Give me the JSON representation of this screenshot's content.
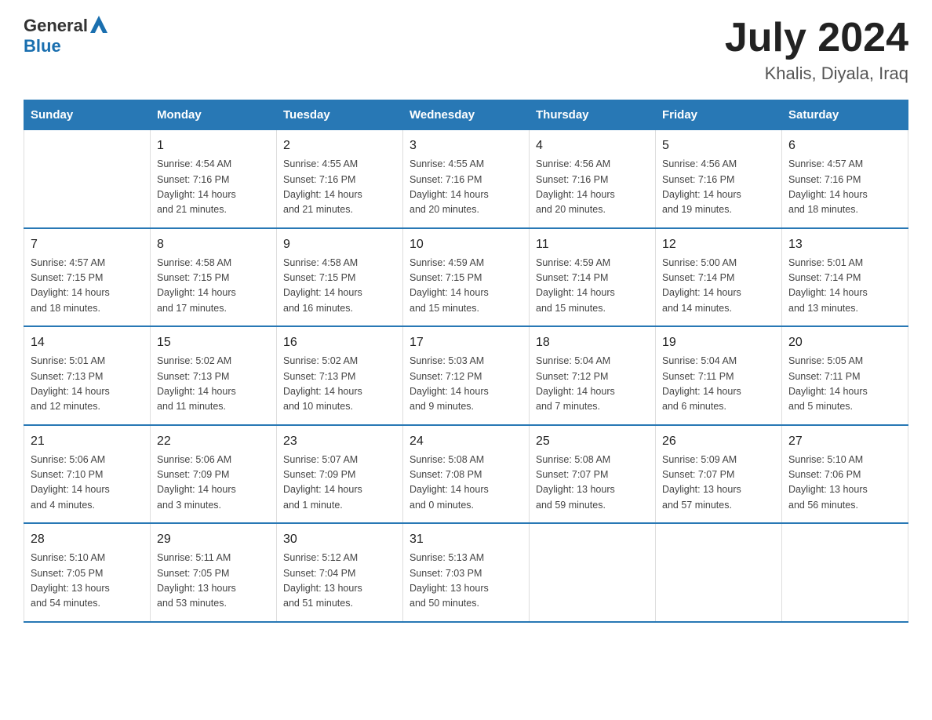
{
  "logo": {
    "text_general": "General",
    "text_blue": "Blue"
  },
  "title": "July 2024",
  "location": "Khalis, Diyala, Iraq",
  "days_of_week": [
    "Sunday",
    "Monday",
    "Tuesday",
    "Wednesday",
    "Thursday",
    "Friday",
    "Saturday"
  ],
  "weeks": [
    [
      {
        "day": "",
        "info": ""
      },
      {
        "day": "1",
        "info": "Sunrise: 4:54 AM\nSunset: 7:16 PM\nDaylight: 14 hours\nand 21 minutes."
      },
      {
        "day": "2",
        "info": "Sunrise: 4:55 AM\nSunset: 7:16 PM\nDaylight: 14 hours\nand 21 minutes."
      },
      {
        "day": "3",
        "info": "Sunrise: 4:55 AM\nSunset: 7:16 PM\nDaylight: 14 hours\nand 20 minutes."
      },
      {
        "day": "4",
        "info": "Sunrise: 4:56 AM\nSunset: 7:16 PM\nDaylight: 14 hours\nand 20 minutes."
      },
      {
        "day": "5",
        "info": "Sunrise: 4:56 AM\nSunset: 7:16 PM\nDaylight: 14 hours\nand 19 minutes."
      },
      {
        "day": "6",
        "info": "Sunrise: 4:57 AM\nSunset: 7:16 PM\nDaylight: 14 hours\nand 18 minutes."
      }
    ],
    [
      {
        "day": "7",
        "info": "Sunrise: 4:57 AM\nSunset: 7:15 PM\nDaylight: 14 hours\nand 18 minutes."
      },
      {
        "day": "8",
        "info": "Sunrise: 4:58 AM\nSunset: 7:15 PM\nDaylight: 14 hours\nand 17 minutes."
      },
      {
        "day": "9",
        "info": "Sunrise: 4:58 AM\nSunset: 7:15 PM\nDaylight: 14 hours\nand 16 minutes."
      },
      {
        "day": "10",
        "info": "Sunrise: 4:59 AM\nSunset: 7:15 PM\nDaylight: 14 hours\nand 15 minutes."
      },
      {
        "day": "11",
        "info": "Sunrise: 4:59 AM\nSunset: 7:14 PM\nDaylight: 14 hours\nand 15 minutes."
      },
      {
        "day": "12",
        "info": "Sunrise: 5:00 AM\nSunset: 7:14 PM\nDaylight: 14 hours\nand 14 minutes."
      },
      {
        "day": "13",
        "info": "Sunrise: 5:01 AM\nSunset: 7:14 PM\nDaylight: 14 hours\nand 13 minutes."
      }
    ],
    [
      {
        "day": "14",
        "info": "Sunrise: 5:01 AM\nSunset: 7:13 PM\nDaylight: 14 hours\nand 12 minutes."
      },
      {
        "day": "15",
        "info": "Sunrise: 5:02 AM\nSunset: 7:13 PM\nDaylight: 14 hours\nand 11 minutes."
      },
      {
        "day": "16",
        "info": "Sunrise: 5:02 AM\nSunset: 7:13 PM\nDaylight: 14 hours\nand 10 minutes."
      },
      {
        "day": "17",
        "info": "Sunrise: 5:03 AM\nSunset: 7:12 PM\nDaylight: 14 hours\nand 9 minutes."
      },
      {
        "day": "18",
        "info": "Sunrise: 5:04 AM\nSunset: 7:12 PM\nDaylight: 14 hours\nand 7 minutes."
      },
      {
        "day": "19",
        "info": "Sunrise: 5:04 AM\nSunset: 7:11 PM\nDaylight: 14 hours\nand 6 minutes."
      },
      {
        "day": "20",
        "info": "Sunrise: 5:05 AM\nSunset: 7:11 PM\nDaylight: 14 hours\nand 5 minutes."
      }
    ],
    [
      {
        "day": "21",
        "info": "Sunrise: 5:06 AM\nSunset: 7:10 PM\nDaylight: 14 hours\nand 4 minutes."
      },
      {
        "day": "22",
        "info": "Sunrise: 5:06 AM\nSunset: 7:09 PM\nDaylight: 14 hours\nand 3 minutes."
      },
      {
        "day": "23",
        "info": "Sunrise: 5:07 AM\nSunset: 7:09 PM\nDaylight: 14 hours\nand 1 minute."
      },
      {
        "day": "24",
        "info": "Sunrise: 5:08 AM\nSunset: 7:08 PM\nDaylight: 14 hours\nand 0 minutes."
      },
      {
        "day": "25",
        "info": "Sunrise: 5:08 AM\nSunset: 7:07 PM\nDaylight: 13 hours\nand 59 minutes."
      },
      {
        "day": "26",
        "info": "Sunrise: 5:09 AM\nSunset: 7:07 PM\nDaylight: 13 hours\nand 57 minutes."
      },
      {
        "day": "27",
        "info": "Sunrise: 5:10 AM\nSunset: 7:06 PM\nDaylight: 13 hours\nand 56 minutes."
      }
    ],
    [
      {
        "day": "28",
        "info": "Sunrise: 5:10 AM\nSunset: 7:05 PM\nDaylight: 13 hours\nand 54 minutes."
      },
      {
        "day": "29",
        "info": "Sunrise: 5:11 AM\nSunset: 7:05 PM\nDaylight: 13 hours\nand 53 minutes."
      },
      {
        "day": "30",
        "info": "Sunrise: 5:12 AM\nSunset: 7:04 PM\nDaylight: 13 hours\nand 51 minutes."
      },
      {
        "day": "31",
        "info": "Sunrise: 5:13 AM\nSunset: 7:03 PM\nDaylight: 13 hours\nand 50 minutes."
      },
      {
        "day": "",
        "info": ""
      },
      {
        "day": "",
        "info": ""
      },
      {
        "day": "",
        "info": ""
      }
    ]
  ]
}
